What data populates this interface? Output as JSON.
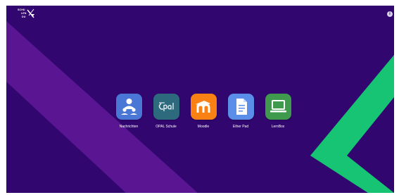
{
  "window": {
    "background": "#32066f",
    "logo": {
      "lines": [
        "SCHU",
        "LEN",
        "DU"
      ],
      "icon": "quill-icon"
    },
    "info_glyph": "i"
  },
  "apps": [
    {
      "label": "Nachrichten",
      "icon": "messenger-icon",
      "color": "#4a77d6"
    },
    {
      "label": "OPAL Schule",
      "icon": "opal-icon",
      "color": "#2d6a7e"
    },
    {
      "label": "Moodle",
      "icon": "moodle-icon",
      "color": "#f98012"
    },
    {
      "label": "Ether Pad",
      "icon": "document-icon",
      "color": "#5b8ee8"
    },
    {
      "label": "LernBox",
      "icon": "laptop-icon",
      "color": "#3f9a4e"
    }
  ],
  "colors": {
    "purple_stripe": "#5a1692",
    "green_chevron": "#17c474"
  }
}
